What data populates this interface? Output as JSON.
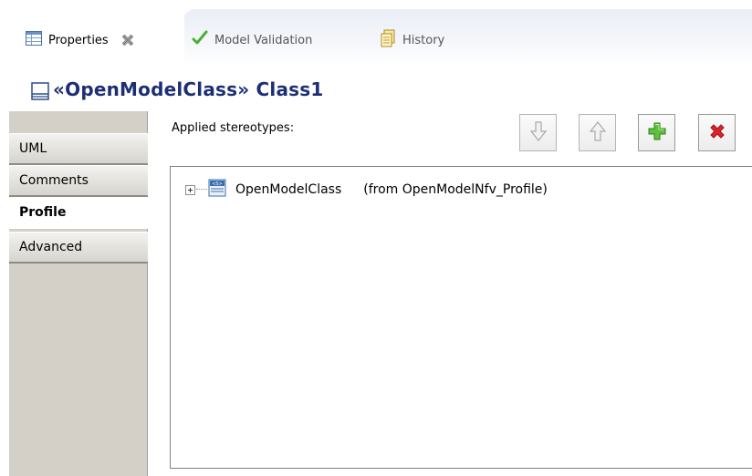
{
  "tabs": [
    {
      "label": "Properties",
      "icon": "properties-table-icon",
      "active": true,
      "closable": true
    },
    {
      "label": "Model Validation",
      "icon": "checkmark-icon",
      "active": false
    },
    {
      "label": "History",
      "icon": "history-document-icon",
      "active": false
    }
  ],
  "header": {
    "title": "«OpenModelClass» Class1",
    "icon": "class-icon"
  },
  "sidebar": {
    "items": [
      {
        "label": "UML",
        "selected": false
      },
      {
        "label": "Comments",
        "selected": false
      },
      {
        "label": "Profile",
        "selected": true
      },
      {
        "label": "Advanced",
        "selected": false
      }
    ]
  },
  "main": {
    "applied_label": "Applied stereotypes:",
    "toolbar": [
      {
        "name": "move-down",
        "icon": "arrow-down-icon",
        "enabled": false
      },
      {
        "name": "move-up",
        "icon": "arrow-up-icon",
        "enabled": false
      },
      {
        "name": "add",
        "icon": "plus-icon",
        "enabled": true
      },
      {
        "name": "remove",
        "icon": "delete-x-icon",
        "enabled": true
      }
    ],
    "tree": [
      {
        "label": "OpenModelClass",
        "from": "(from OpenModelNfv_Profile)",
        "icon": "stereotype-icon",
        "expanded": false
      }
    ]
  },
  "colors": {
    "title": "#1c2f74",
    "sidebar_bg": "#d4d0c8",
    "add_green": "#3fae2a",
    "remove_red": "#e0242c",
    "check_green": "#4caf2e"
  }
}
